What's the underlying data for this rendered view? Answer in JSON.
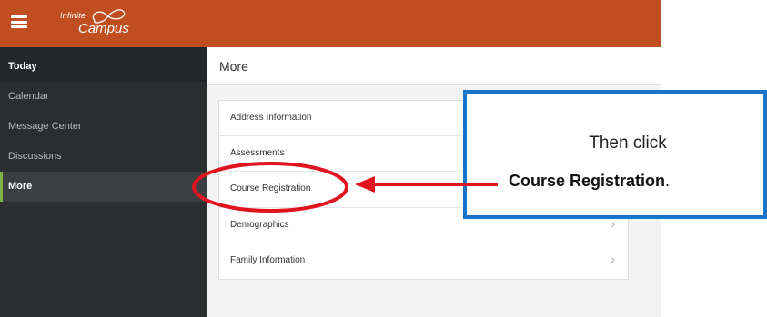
{
  "header": {
    "logo_line1": "Infinite",
    "logo_line2": "Campus"
  },
  "sidebar": {
    "items": [
      {
        "label": "Today"
      },
      {
        "label": "Calendar"
      },
      {
        "label": "Message Center"
      },
      {
        "label": "Discussions"
      },
      {
        "label": "More"
      }
    ]
  },
  "main": {
    "title": "More",
    "menu": [
      {
        "label": "Address Information"
      },
      {
        "label": "Assessments"
      },
      {
        "label": "Course Registration"
      },
      {
        "label": "Demographics"
      },
      {
        "label": "Family Information"
      }
    ],
    "chevron": "›"
  },
  "annotation": {
    "line1": "Then click",
    "line2_bold": "Course Registration",
    "line2_end": ".",
    "box_color": "#1874c9",
    "highlight_color": "#e0141e"
  },
  "colors": {
    "topbar": "#c04e21",
    "sidebar": "#2a2e2f",
    "active_indicator": "#7cb342"
  }
}
